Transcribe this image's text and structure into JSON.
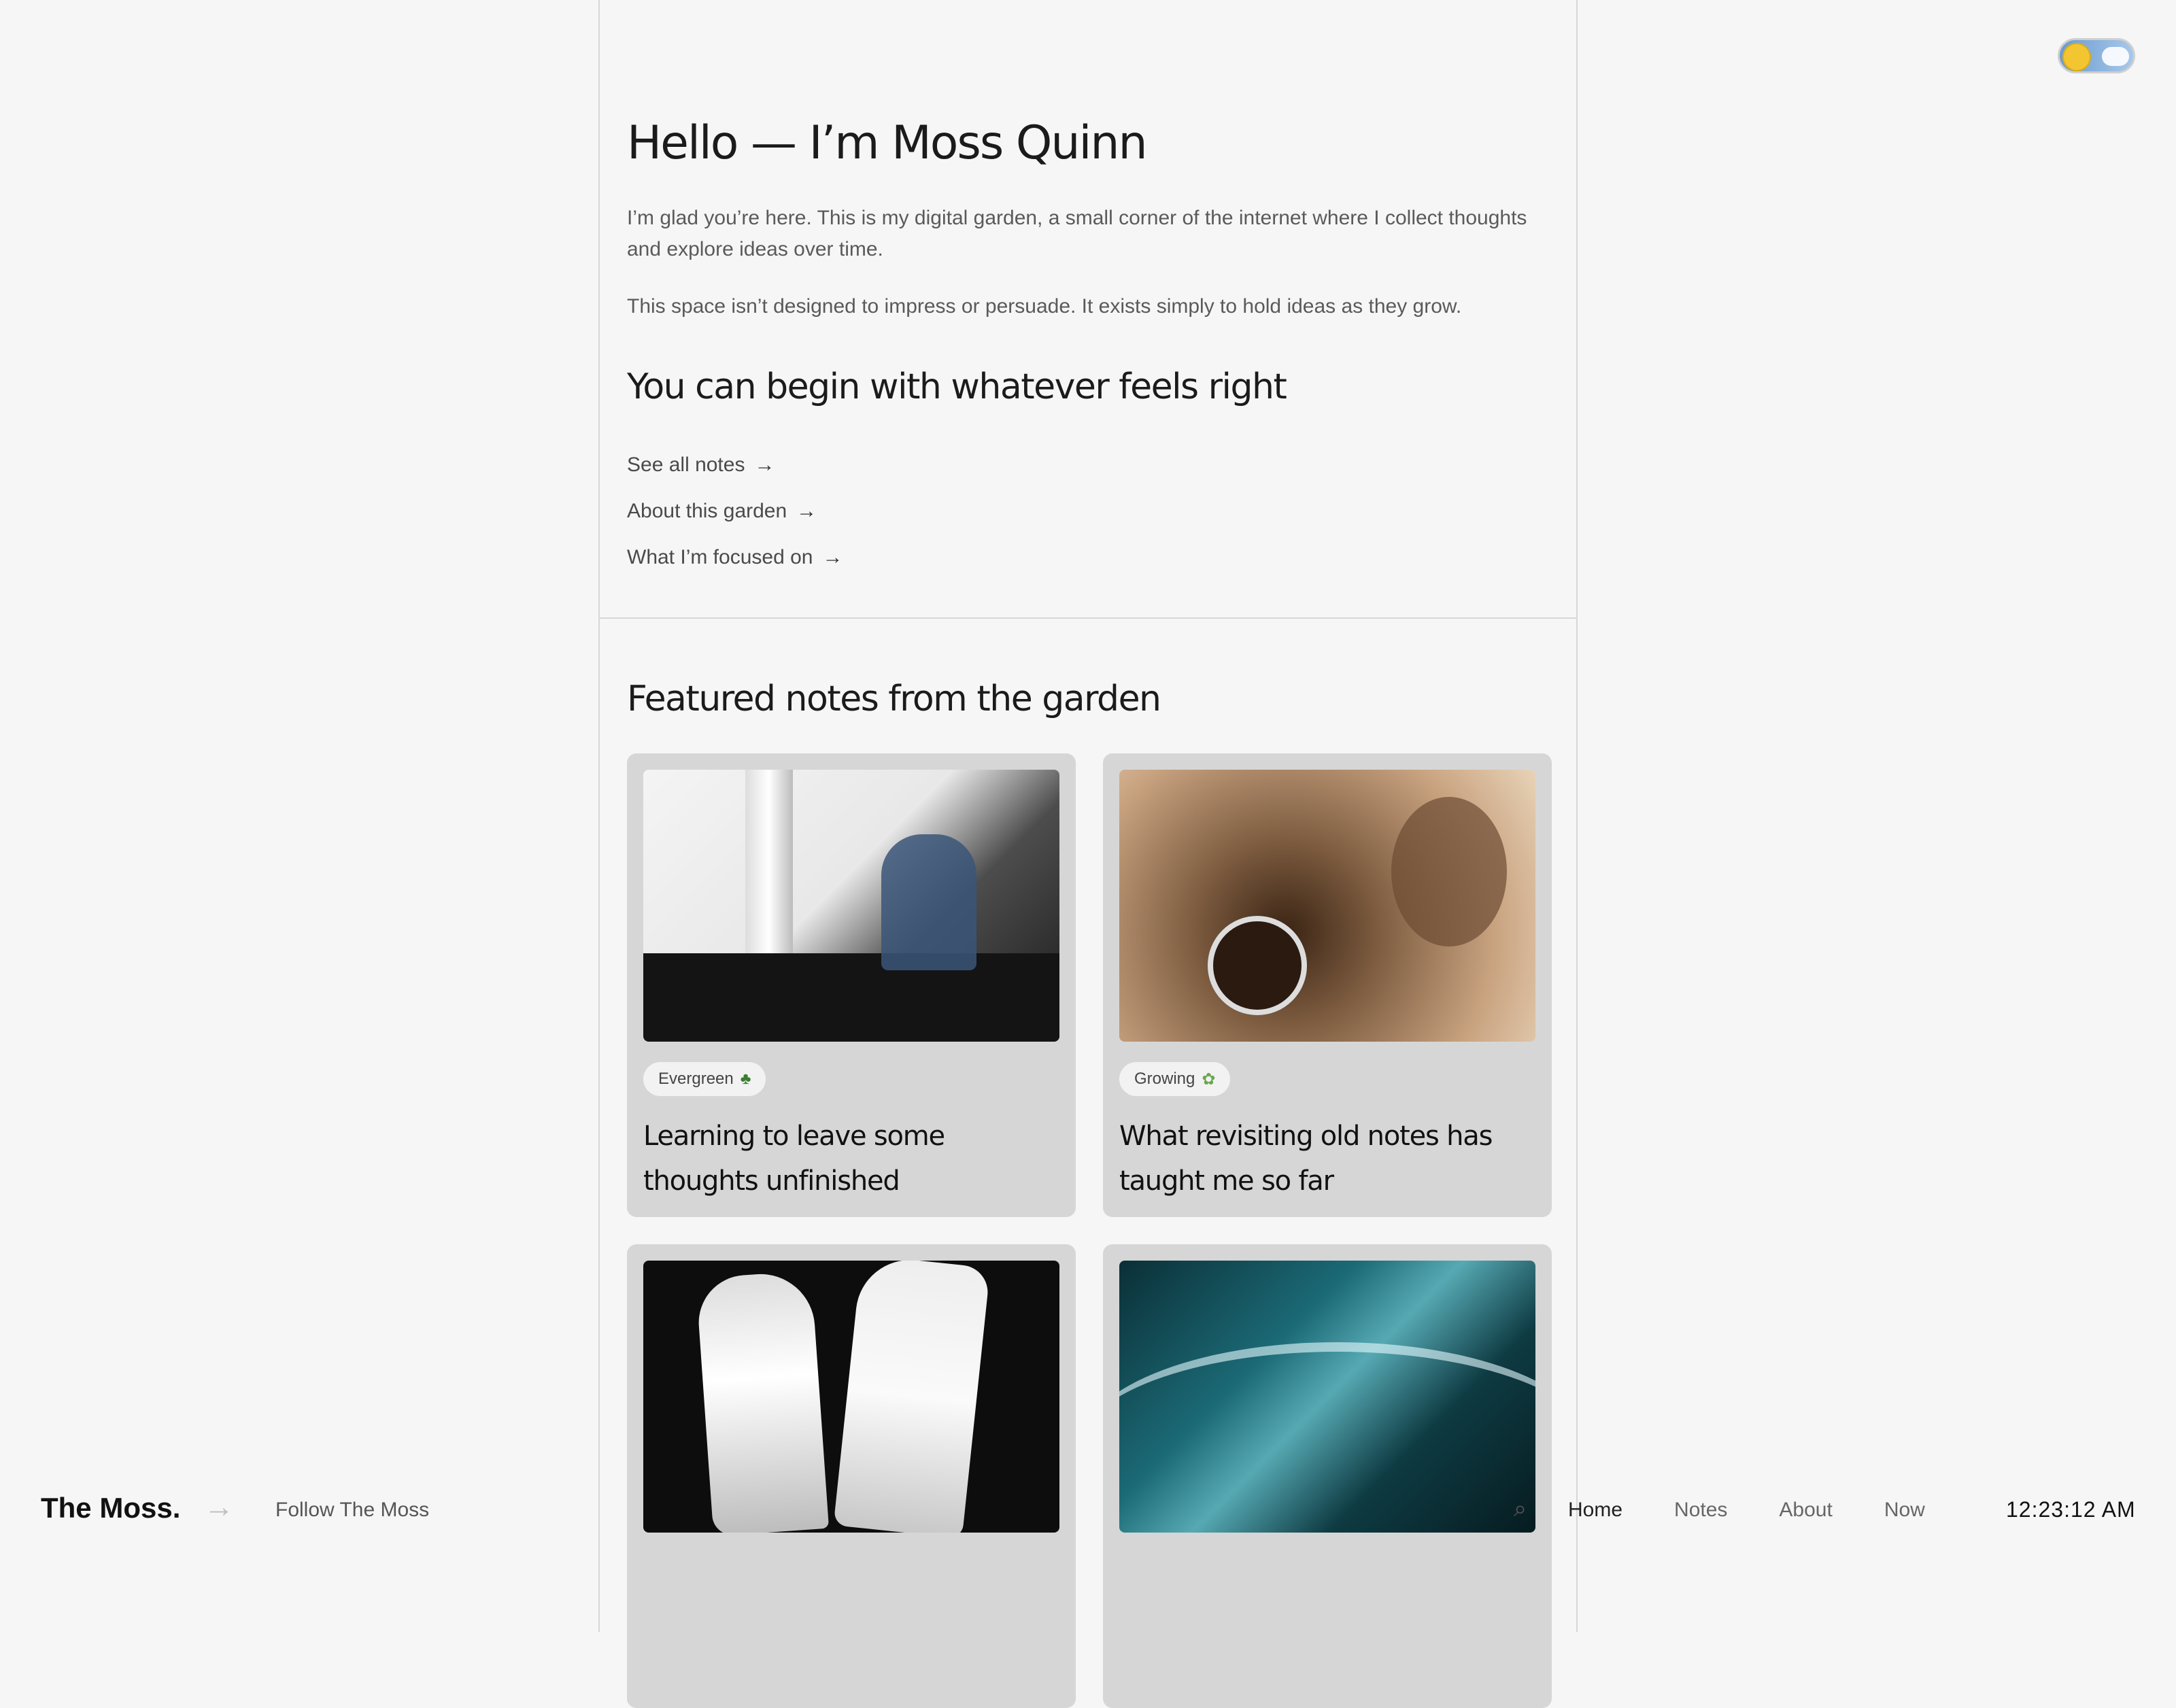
{
  "intro": {
    "title": "Hello — I’m Moss Quinn",
    "paragraph1": "I’m glad you’re here. This is my digital garden, a small corner of the internet where I collect thoughts and explore ideas over time.",
    "paragraph2": "This space isn’t designed to impress or persuade. It exists simply to hold ideas as they grow.",
    "begin_heading": "You can begin with whatever feels right",
    "links": [
      {
        "label": "See all notes",
        "icon": "arrow-right-icon"
      },
      {
        "label": "About this garden",
        "icon": "arrow-right-icon"
      },
      {
        "label": "What I’m focused on",
        "icon": "arrow-right-icon"
      }
    ]
  },
  "featured": {
    "heading": "Featured notes from the garden",
    "cards": [
      {
        "tag": "Evergreen",
        "tag_icon": "tree-icon",
        "title": "Learning to leave some thoughts unfinished"
      },
      {
        "tag": "Growing",
        "tag_icon": "sprout-icon",
        "title": "What revisiting old notes has taught me so far"
      },
      {
        "tag": "",
        "tag_icon": "",
        "title": ""
      },
      {
        "tag": "",
        "tag_icon": "",
        "title": ""
      }
    ]
  },
  "toggle": {
    "icon": "theme-toggle-icon",
    "state": "light"
  },
  "footer": {
    "brand": "The Moss.",
    "follow": "Follow The Moss",
    "search_icon": "search-icon",
    "nav": [
      "Home",
      "Notes",
      "About",
      "Now"
    ],
    "active_nav": "Home",
    "time": "12:23:12 AM"
  },
  "colors": {
    "background": "#f6f6f6",
    "card": "#d6d6d6",
    "pill": "#f2f2f2"
  }
}
